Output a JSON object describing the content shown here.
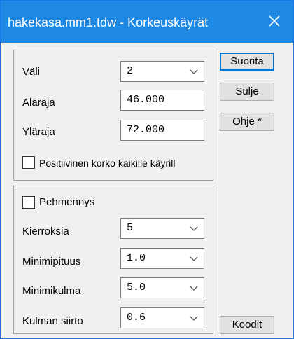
{
  "window": {
    "title": "hakekasa.mm1.tdw - Korkeuskäyrät"
  },
  "icons": {
    "close": "close-icon",
    "dropdown": "chevron-down-icon"
  },
  "colors": {
    "titlebar": "#1e88e5",
    "title_text": "#ffffff",
    "dialog_bg": "#f0f0f0",
    "default_button_border": "#0078d7"
  },
  "contours": {
    "interval": {
      "label": "Väli",
      "value": "2"
    },
    "lower_limit": {
      "label": "Alaraja",
      "value": "46.000"
    },
    "upper_limit": {
      "label": "Yläraja",
      "value": "72.000"
    },
    "positive_height_label": "Positiivinen korko kaikille käyrill"
  },
  "smoothing": {
    "checkbox_label": "Pehmennys",
    "rounds": {
      "label": "Kierroksia",
      "value": "5"
    },
    "min_length": {
      "label": "Minimipituus",
      "value": "1.0"
    },
    "min_angle": {
      "label": "Minimikulma",
      "value": "5.0"
    },
    "angle_shift": {
      "label": "Kulman siirto",
      "value": "0.6"
    }
  },
  "buttons": {
    "run": "Suorita",
    "close": "Sulje",
    "help": "Ohje *",
    "codes": "Koodit"
  }
}
